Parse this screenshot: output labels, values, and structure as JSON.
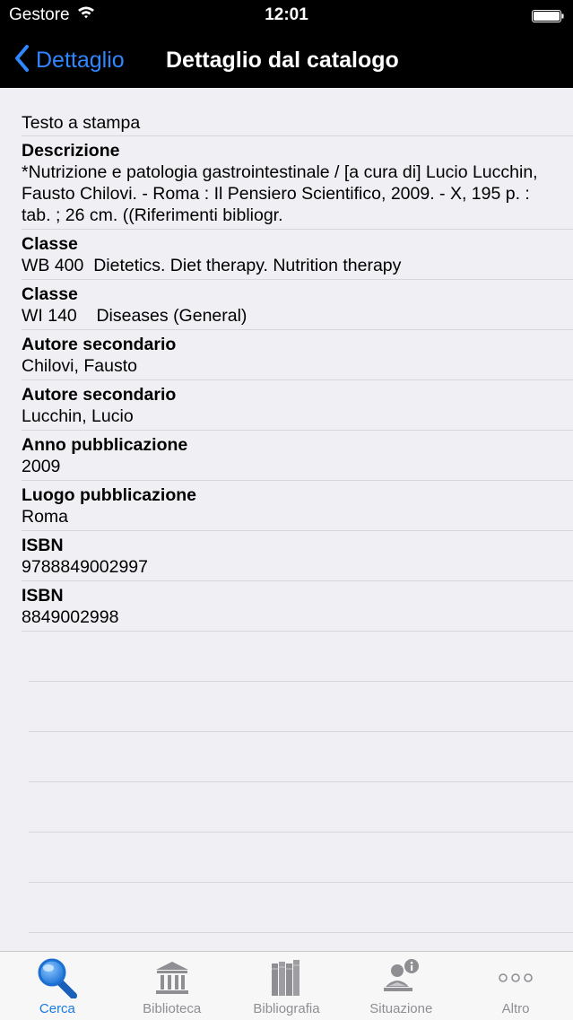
{
  "status_bar": {
    "carrier": "Gestore",
    "time": "12:01"
  },
  "nav": {
    "back_label": "Dettaglio",
    "title": "Dettaglio dal catalogo"
  },
  "record": {
    "type": "Testo a stampa",
    "fields": [
      {
        "label": "Descrizione",
        "value": "*Nutrizione e patologia gastrointestinale / [a cura di] Lucio Lucchin, Fausto Chilovi. - Roma : Il Pensiero Scientifico, 2009. - X, 195 p. : tab. ; 26 cm. ((Riferimenti bibliogr."
      },
      {
        "label": "Classe",
        "value": "WB 400  Dietetics. Diet therapy. Nutrition therapy"
      },
      {
        "label": "Classe",
        "value": "WI 140    Diseases (General)"
      },
      {
        "label": "Autore secondario",
        "value": "Chilovi, Fausto"
      },
      {
        "label": "Autore secondario",
        "value": "Lucchin, Lucio"
      },
      {
        "label": "Anno pubblicazione",
        "value": "2009"
      },
      {
        "label": "Luogo pubblicazione",
        "value": "Roma"
      },
      {
        "label": "ISBN",
        "value": "9788849002997"
      },
      {
        "label": "ISBN",
        "value": "8849002998"
      }
    ]
  },
  "tabs": [
    {
      "label": "Cerca",
      "icon": "search-icon",
      "active": true
    },
    {
      "label": "Biblioteca",
      "icon": "library-icon",
      "active": false
    },
    {
      "label": "Bibliografia",
      "icon": "books-icon",
      "active": false
    },
    {
      "label": "Situazione",
      "icon": "reader-info-icon",
      "active": false
    },
    {
      "label": "Altro",
      "icon": "more-icon",
      "active": false
    }
  ],
  "colors": {
    "accent": "#1a7be0",
    "nav_back": "#2f87ff",
    "tab_inactive": "#8e8e93",
    "background": "#efeff4"
  }
}
